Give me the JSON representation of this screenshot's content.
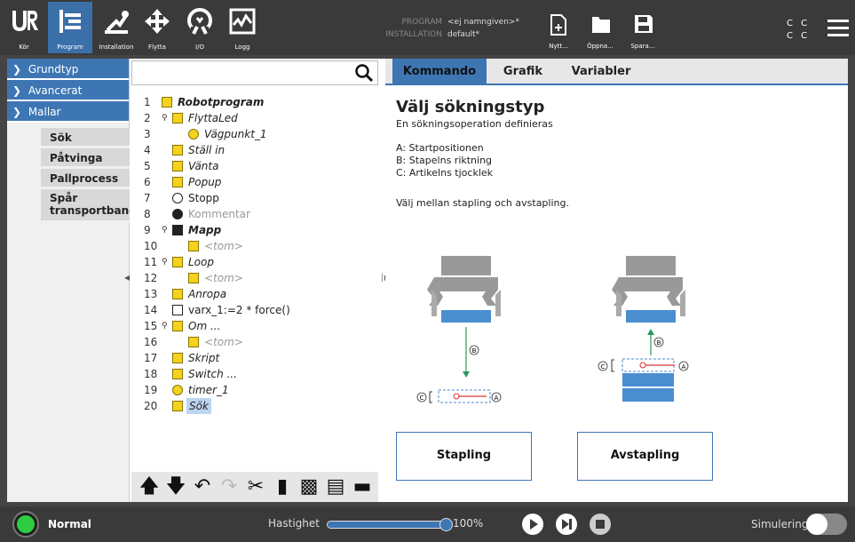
{
  "top_nav": {
    "items": [
      {
        "label": "Kör",
        "icon": "ur-logo-icon"
      },
      {
        "label": "Program",
        "icon": "program-icon",
        "active": true
      },
      {
        "label": "Installation",
        "icon": "installation-icon"
      },
      {
        "label": "Flytta",
        "icon": "move-arrows-icon"
      },
      {
        "label": "I/O",
        "icon": "io-icon"
      },
      {
        "label": "Logg",
        "icon": "log-icon"
      }
    ]
  },
  "program_info": {
    "program_key": "PROGRAM",
    "program_value": "<ej namngiven>*",
    "installation_key": "INSTALLATION",
    "installation_value": "default*"
  },
  "file_buttons": {
    "new": "Nytt...",
    "open": "Öppna...",
    "save": "Spara..."
  },
  "cc": {
    "line1": "C C",
    "line2": "C C"
  },
  "left_panel": {
    "categories": [
      {
        "label": "Grundtyp",
        "chevron": ">"
      },
      {
        "label": "Avancerat",
        "chevron": ">"
      },
      {
        "label": "Mallar",
        "chevron": "v"
      }
    ],
    "templates": [
      "Sök",
      "Påtvinga",
      "Pallprocess",
      "Spår transportband"
    ]
  },
  "tree": {
    "rows": [
      {
        "n": "1",
        "label": "Robotprogram"
      },
      {
        "n": "2",
        "label": "FlyttaLed"
      },
      {
        "n": "3",
        "label": "Vägpunkt_1"
      },
      {
        "n": "4",
        "label": "Ställ in"
      },
      {
        "n": "5",
        "label": "Vänta"
      },
      {
        "n": "6",
        "label": "Popup"
      },
      {
        "n": "7",
        "label": "Stopp"
      },
      {
        "n": "8",
        "label": "Kommentar"
      },
      {
        "n": "9",
        "label": "Mapp"
      },
      {
        "n": "10",
        "label": "<tom>"
      },
      {
        "n": "11",
        "label": "Loop"
      },
      {
        "n": "12",
        "label": "<tom>"
      },
      {
        "n": "13",
        "label": "Anropa"
      },
      {
        "n": "14",
        "label": "varx_1:=2 * force()"
      },
      {
        "n": "15",
        "label": "Om ..."
      },
      {
        "n": "16",
        "label": "<tom>"
      },
      {
        "n": "17",
        "label": "Skript"
      },
      {
        "n": "18",
        "label": "Switch ..."
      },
      {
        "n": "19",
        "label": "timer_1"
      },
      {
        "n": "20",
        "label": "Sök"
      }
    ]
  },
  "tree_toolbar": [
    "arrow-up-icon",
    "arrow-down-icon",
    "undo-icon",
    "redo-icon",
    "cut-icon",
    "copy-icon",
    "paste-icon",
    "delete-icon",
    "suppress-icon"
  ],
  "tabs": [
    "Kommando",
    "Grafik",
    "Variabler"
  ],
  "command": {
    "title": "Välj sökningstyp",
    "subtitle": "En sökningsoperation definieras",
    "lines": [
      "A: Startpositionen",
      "B: Stapelns riktning",
      "C: Artikelns tjocklek"
    ],
    "choose": "Välj mellan stapling och avstapling.",
    "diagram_labels": {
      "a": "A",
      "b": "B",
      "c": "C"
    },
    "btn_stack": "Stapling",
    "btn_destack": "Avstapling"
  },
  "bottom": {
    "status": "Normal",
    "speed_label": "Hastighet",
    "speed_value": "100%",
    "speed_fraction": 1.0,
    "sim_label": "Simulering"
  },
  "colors": {
    "accent": "#3e76b4",
    "status": "#2ecc40",
    "node": "#f4d21e"
  }
}
